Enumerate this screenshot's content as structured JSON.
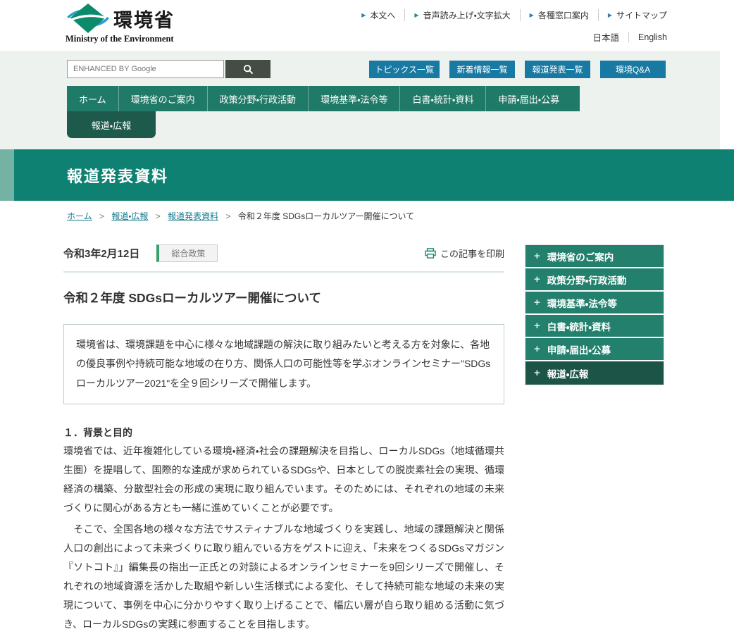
{
  "header": {
    "logo": {
      "title": "環境省",
      "subtitle": "Ministry of the Environment"
    },
    "arrow_marker": "▶",
    "utility_links": [
      "本文へ",
      "音声読み上げ・文字拡大",
      "各種窓口案内",
      "サイトマップ"
    ],
    "lang_links": [
      "日本語",
      "English"
    ]
  },
  "search": {
    "placeholder": "ENHANCED BY Google"
  },
  "quick_links": [
    "トピックス一覧",
    "新着情報一覧",
    "報道発表一覧",
    "環境Q&A"
  ],
  "nav": {
    "items": [
      "ホーム",
      "環境省のご案内",
      "政策分野・行政活動",
      "環境基準・法令等",
      "白書・統計・資料",
      "申請・届出・公募"
    ],
    "active_tab": "報道・広報"
  },
  "banner": {
    "title": "報道発表資料"
  },
  "breadcrumb": {
    "links": [
      "ホーム",
      "報道・広報",
      "報道発表資料"
    ],
    "separator": ">",
    "current": "令和２年度 SDGsローカルツアー開催について"
  },
  "article": {
    "date": "令和3年2月12日",
    "category": "総合政策",
    "print_label": "この記事を印刷",
    "title": "令和２年度 SDGsローカルツアー開催について",
    "summary": "環境省は、環境課題を中心に様々な地域課題の解決に取り組みたいと考える方を対象に、各地の優良事例や持続可能な地域の在り方、関係人口の可能性等を学ぶオンラインセミナー\"SDGsローカルツアー2021\"を全９回シリーズで開催します。",
    "section1_heading": "１．背景と目的",
    "section1_para1": "環境省では、近年複雑化している環境・経済・社会の課題解決を目指し、ローカルSDGs（地域循環共生圏）を提唱して、国際的な達成が求められているSDGsや、日本としての脱炭素社会の実現、循環経済の構築、分散型社会の形成の実現に取り組んでいます。そのためには、それぞれの地域の未来づくりに関心がある方とも一緒に進めていくことが必要です。",
    "section1_para2": "　そこで、全国各地の様々な方法でサスティナブルな地域づくりを実践し、地域の課題解決と関係人口の創出によって未来づくりに取り組んでいる方をゲストに迎え、「未来をつくるSDGsマガジン『ソトコト』」編集長の指出一正氏との対談によるオンラインセミナーを9回シリーズで開催し、それぞれの地域資源を活かした取組や新しい生活様式による変化、そして持続可能な地域の未来の実現について、事例を中心に分かりやすく取り上げることで、幅広い層が自ら取り組める活動に気づき、ローカルSDGsの実践に参画することを目指します。"
  },
  "sidebar": {
    "plus_icon": "+",
    "items": [
      "環境省のご案内",
      "政策分野・行政活動",
      "環境基準・法令等",
      "白書・統計・資料",
      "申請・届出・公募",
      "報道・広報"
    ]
  },
  "colors": {
    "nav_green": "#207a68",
    "active_dark_green": "#1d5a4b",
    "banner_teal": "#0e8173",
    "banner_strip": "#74b2a3",
    "sidebar_green": "#23806c",
    "sidebar_active": "#1c5548",
    "quick_button_blue": "#1879a2",
    "link_teal": "#17798f",
    "tag_border_green": "#38a06e"
  }
}
